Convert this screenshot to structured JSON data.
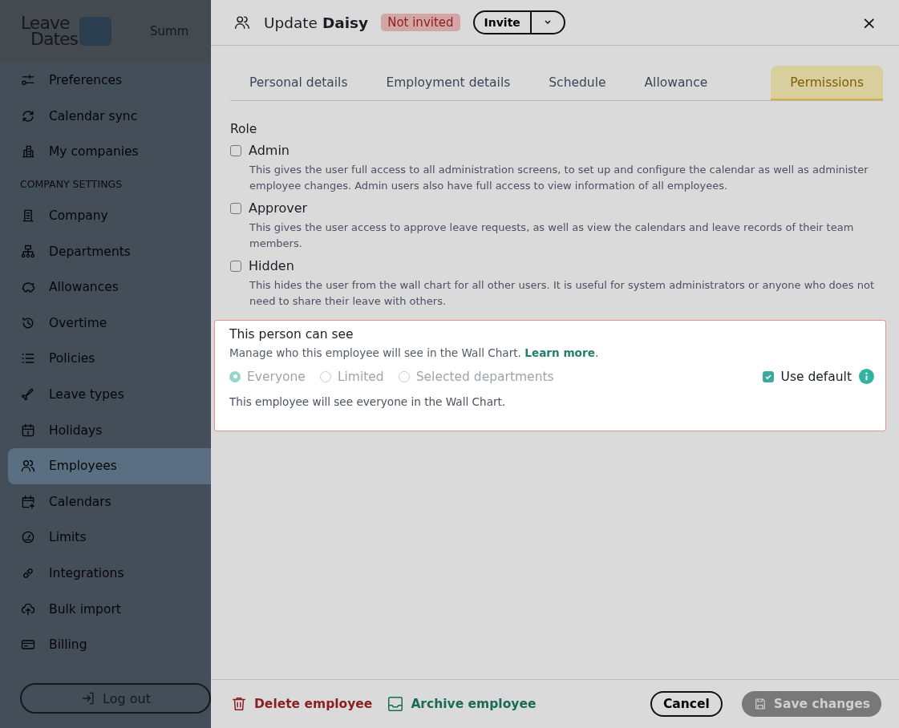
{
  "sidebar": {
    "logo": [
      "Leave",
      "Dates"
    ],
    "top_nav_text": "Summ",
    "items": [
      {
        "kind": "item",
        "label": "Preferences",
        "selected": false
      },
      {
        "kind": "item",
        "label": "Calendar sync",
        "selected": false
      },
      {
        "kind": "item",
        "label": "My companies",
        "selected": false
      },
      {
        "kind": "section",
        "label": "COMPANY SETTINGS"
      },
      {
        "kind": "item",
        "label": "Company",
        "selected": false
      },
      {
        "kind": "item",
        "label": "Departments",
        "selected": false
      },
      {
        "kind": "item",
        "label": "Allowances",
        "selected": false
      },
      {
        "kind": "item",
        "label": "Overtime",
        "selected": false
      },
      {
        "kind": "item",
        "label": "Policies",
        "selected": false
      },
      {
        "kind": "item",
        "label": "Leave types",
        "selected": false
      },
      {
        "kind": "item",
        "label": "Holidays",
        "selected": false
      },
      {
        "kind": "item",
        "label": "Employees",
        "selected": true
      },
      {
        "kind": "item",
        "label": "Calendars",
        "selected": false
      },
      {
        "kind": "item",
        "label": "Limits",
        "selected": false
      },
      {
        "kind": "item",
        "label": "Integrations",
        "selected": false
      },
      {
        "kind": "item",
        "label": "Bulk import",
        "selected": false
      },
      {
        "kind": "item",
        "label": "Billing",
        "selected": false
      }
    ],
    "logout": "Log out"
  },
  "modal": {
    "title": "Update **Daisy**",
    "badge": "Not invited",
    "invite_button": "Invite",
    "close": "×",
    "tabs": [
      {
        "label": "Personal details",
        "selected": false
      },
      {
        "label": "Employment details",
        "selected": false
      },
      {
        "label": "Schedule",
        "selected": false
      },
      {
        "label": "Allowance",
        "selected": false
      },
      {
        "label": "Permissions",
        "selected": true
      }
    ],
    "role_heading": "Role",
    "roles": [
      {
        "label": "Admin",
        "checked": false,
        "description": "This gives the user full access to all administration screens, to set up and configure the calendar as well as administer employee changes. Admin users also have full access to view information of all employees."
      },
      {
        "label": "Approver",
        "checked": false,
        "description": "This gives the user access to approve leave requests, as well as view the calendars and leave records of their team members."
      },
      {
        "label": "Hidden",
        "checked": false,
        "description": "This hides the user from the wall chart for all other users. It is useful for system administrators or anyone who does not need to share their leave with others."
      }
    ],
    "visibility": {
      "title": "This person can see",
      "description": "Manage who this employee will see in the Wall Chart.",
      "link": "Learn more",
      "after_link": ".",
      "options": [
        {
          "label": "Everyone",
          "selected": true
        },
        {
          "label": "Limited",
          "selected": false
        },
        {
          "label": "Selected departments",
          "selected": false
        }
      ],
      "disabled": true,
      "use_default": {
        "label": "Use default",
        "checked": true
      },
      "note": "This employee will see everyone in the Wall Chart."
    },
    "footer": {
      "delete": "Delete employee",
      "archive": "Archive employee",
      "cancel": "Cancel",
      "save": {
        "label": "Save changes",
        "disabled": true
      }
    }
  }
}
